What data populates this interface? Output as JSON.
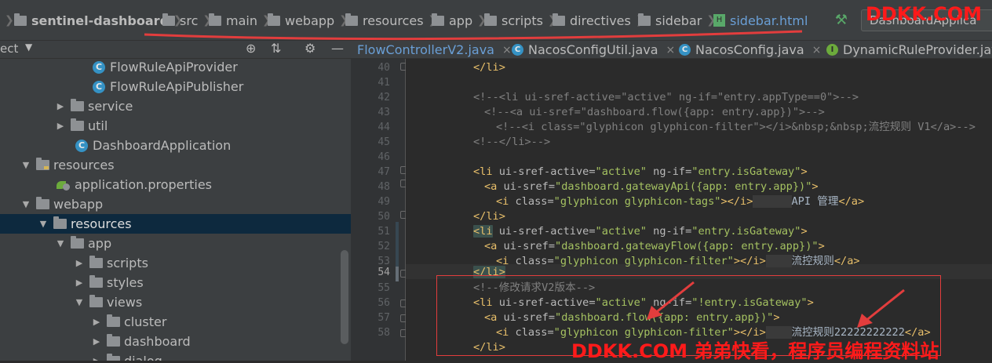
{
  "breadcrumb": {
    "project": "sentinel-dashboard",
    "items": [
      "src",
      "main",
      "webapp",
      "resources",
      "app",
      "scripts",
      "directives",
      "sidebar"
    ],
    "file": "sidebar.html"
  },
  "run_config": "DashboardApplica",
  "watermark_top": "DDKK.COM",
  "watermark_bottom": "DDKK.COM 弟弟快看，程序员编程资料站",
  "project_panel": {
    "label": "ect"
  },
  "project_tree": [
    {
      "label": "FlowRuleApiProvider",
      "icon": "class-icon"
    },
    {
      "label": "FlowRuleApiPublisher",
      "icon": "class-icon"
    },
    {
      "label": "service",
      "icon": "package-icon"
    },
    {
      "label": "util",
      "icon": "package-icon"
    },
    {
      "label": "DashboardApplication",
      "icon": "class-icon"
    },
    {
      "label": "resources",
      "icon": "resources-folder-icon"
    },
    {
      "label": "application.properties",
      "icon": "properties-file-icon"
    },
    {
      "label": "webapp",
      "icon": "folder-icon"
    },
    {
      "label": "resources",
      "icon": "folder-icon"
    },
    {
      "label": "app",
      "icon": "folder-icon"
    },
    {
      "label": "scripts",
      "icon": "folder-icon"
    },
    {
      "label": "styles",
      "icon": "folder-icon"
    },
    {
      "label": "views",
      "icon": "folder-icon"
    },
    {
      "label": "cluster",
      "icon": "folder-icon"
    },
    {
      "label": "dashboard",
      "icon": "folder-icon"
    },
    {
      "label": "dialog",
      "icon": "folder-icon"
    }
  ],
  "editor_tabs": [
    {
      "label": "FlowControllerV2.java"
    },
    {
      "label": "NacosConfigUtil.java"
    },
    {
      "label": "NacosConfig.java"
    },
    {
      "label": "DynamicRuleProvider.java"
    }
  ],
  "line_numbers": [
    "40",
    "41",
    "42",
    "43",
    "44",
    "45",
    "46",
    "47",
    "48",
    "49",
    "50",
    "51",
    "52",
    "53",
    "54",
    "55",
    "56",
    "57",
    "58"
  ],
  "code": {
    "l40": "</li>",
    "l42": "<!--<li ui-sref-active=\"active\" ng-if=\"entry.appType==0\">-->",
    "l43": "<!--<a ui-sref=\"dashboard.flow({app: entry.app})\">-->",
    "l44": "<!--<i class=\"glyphicon glyphicon-filter\"></i>&nbsp;&nbsp;流控规则 V1</a>-->",
    "l45": "<!--</li>-->",
    "l47_a": "<li",
    "l47_b": " ui-sref-active=",
    "l47_c": "\"active\"",
    "l47_d": " ng-if=",
    "l47_e": "\"entry.isGateway\"",
    "l47_f": ">",
    "l48_a": "<a",
    "l48_b": " ui-sref=",
    "l48_c": "\"dashboard.gatewayApi({app: entry.app})\"",
    "l48_d": ">",
    "l49_a": "<i",
    "l49_b": " class=",
    "l49_c": "\"glyphicon glyphicon-tags\"",
    "l49_d": "></i>",
    "l49_e": "API 管理",
    "l49_f": "</a>",
    "l50": "</li>",
    "l51_a": "<li",
    "l51_b": " ui-sref-active=",
    "l51_c": "\"active\"",
    "l51_d": " ng-if=",
    "l51_e": "\"entry.isGateway\"",
    "l51_f": ">",
    "l52_a": "<a",
    "l52_b": " ui-sref=",
    "l52_c": "\"dashboard.gatewayFlow({app: entry.app})\"",
    "l52_d": ">",
    "l53_a": "<i",
    "l53_b": " class=",
    "l53_c": "\"glyphicon glyphicon-filter\"",
    "l53_d": "></i>",
    "l53_e": "流控规则",
    "l53_f": "</a>",
    "l54": "</li>",
    "l55": "<!--修改请求V2版本-->",
    "l56_a": "<li",
    "l56_b": " ui-sref-active=",
    "l56_c": "\"active\"",
    "l56_d": " ng-if=",
    "l56_e": "\"!entry.isGateway\"",
    "l56_f": ">",
    "l57_a": "<a",
    "l57_b": " ui-sref=",
    "l57_c": "\"dashboard.flow({app: entry.app})\"",
    "l57_d": ">",
    "l58_a": "<i",
    "l58_b": " class=",
    "l58_c": "\"glyphicon glyphicon-filter\"",
    "l58_d": "></i>",
    "l58_e": "流控规则22222222222",
    "l58_f": "</a>",
    "l59": "</li>"
  },
  "colors": {
    "background": "#2b2b2b",
    "tag": "#e8bf6a",
    "attr_value": "#a5c261",
    "comment": "#808080",
    "annotation_red": "#e23d3d"
  }
}
